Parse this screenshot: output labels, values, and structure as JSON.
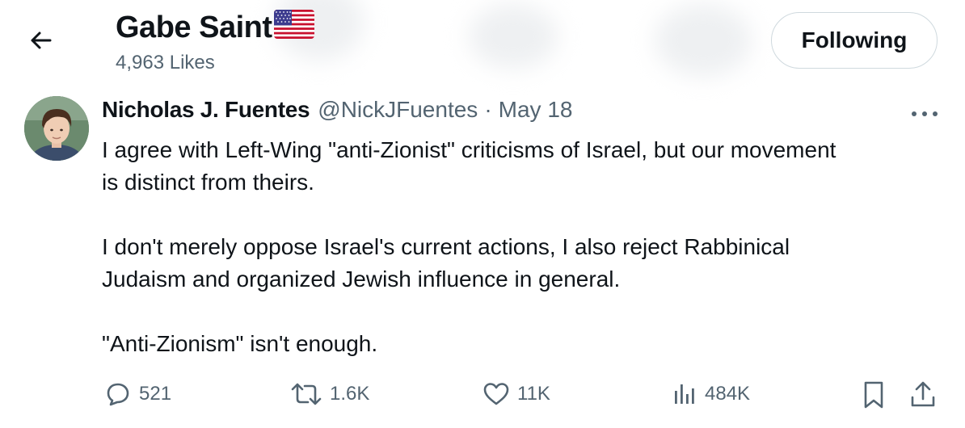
{
  "header": {
    "display_name": "Gabe Saint",
    "name_emoji": "us-flag-icon",
    "likes_text": "4,963 Likes",
    "follow_button_label": "Following"
  },
  "tweet": {
    "author_name": "Nicholas J. Fuentes",
    "handle": "@NickJFuentes",
    "separator": "·",
    "date": "May 18",
    "lines": [
      "I agree with Left-Wing \"anti-Zionist\" criticisms of Israel, but our movement",
      "is distinct from theirs.",
      "I don't merely oppose Israel's current actions, I also reject Rabbinical",
      "Judaism and organized Jewish influence in general.",
      "\"Anti-Zionism\" isn't enough."
    ]
  },
  "actions": {
    "replies": "521",
    "reposts": "1.6K",
    "likes": "11K",
    "views": "484K"
  },
  "colors": {
    "text_primary": "#0f1419",
    "text_secondary": "#536471",
    "border": "#cfd9de"
  }
}
